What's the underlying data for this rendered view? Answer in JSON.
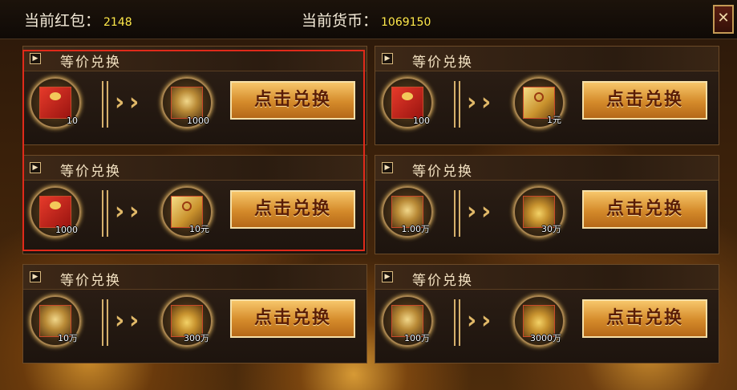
{
  "header": {
    "hongbao_label": "当前红包：",
    "hongbao_value": "2148",
    "currency_label": "当前货币：",
    "currency_value": "1069150",
    "close_symbol": "✕"
  },
  "cards": [
    {
      "title": "等价兑换",
      "from_icon": "red-envelope-icon",
      "from_qty": "10",
      "to_icon": "copper-coin-icon",
      "to_qty": "1000",
      "button": "点击兑换"
    },
    {
      "title": "等价兑换",
      "from_icon": "red-envelope-icon",
      "from_qty": "100",
      "to_icon": "gold-ticket-icon",
      "to_qty": "1元",
      "button": "点击兑换"
    },
    {
      "title": "等价兑换",
      "from_icon": "red-envelope-icon",
      "from_qty": "1000",
      "to_icon": "gold-ticket-icon",
      "to_qty": "10元",
      "button": "点击兑换"
    },
    {
      "title": "等价兑换",
      "from_icon": "copper-coin-icon",
      "from_qty": "1.00万",
      "to_icon": "gold-ingot-icon",
      "to_qty": "30万",
      "button": "点击兑换"
    },
    {
      "title": "等价兑换",
      "from_icon": "copper-coin-icon",
      "from_qty": "10万",
      "to_icon": "gold-ingot-icon",
      "to_qty": "300万",
      "button": "点击兑换"
    },
    {
      "title": "等价兑换",
      "from_icon": "copper-coin-icon",
      "from_qty": "100万",
      "to_icon": "gold-ingot-icon",
      "to_qty": "3000万",
      "button": "点击兑换"
    }
  ],
  "colors": {
    "accent_gold": "#ffe94a",
    "button_text": "#5a1d06",
    "highlight_border": "#e02a1a"
  }
}
